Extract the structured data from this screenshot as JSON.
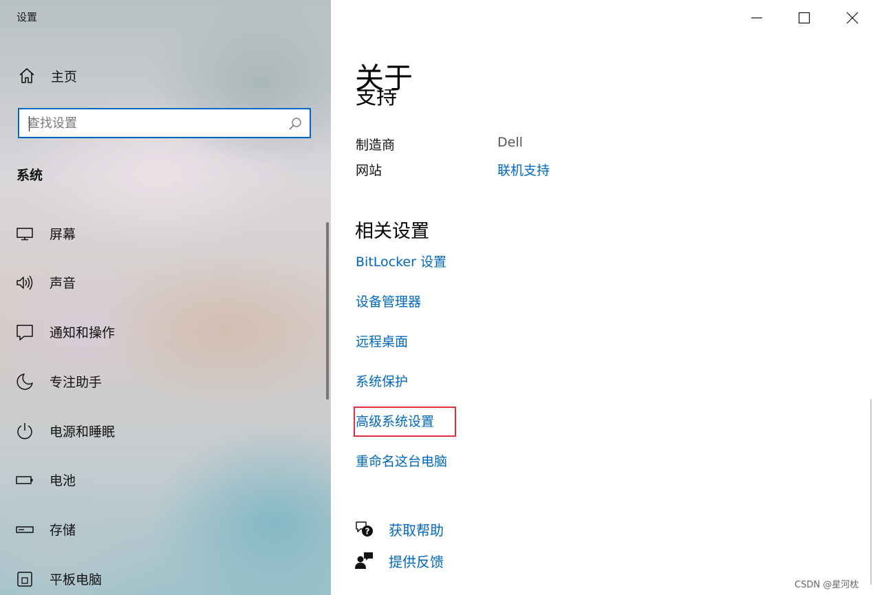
{
  "window": {
    "title": "设置"
  },
  "sidebar": {
    "home_label": "主页",
    "search_placeholder": "查找设置",
    "section_label": "系统",
    "items": [
      {
        "label": "屏幕",
        "icon": "monitor-icon"
      },
      {
        "label": "声音",
        "icon": "speaker-icon"
      },
      {
        "label": "通知和操作",
        "icon": "notification-icon"
      },
      {
        "label": "专注助手",
        "icon": "moon-icon"
      },
      {
        "label": "电源和睡眠",
        "icon": "power-icon"
      },
      {
        "label": "电池",
        "icon": "battery-icon"
      },
      {
        "label": "存储",
        "icon": "storage-icon"
      },
      {
        "label": "平板电脑",
        "icon": "tablet-icon"
      }
    ]
  },
  "content": {
    "page_title": "关于",
    "clipped_heading": "支持",
    "support": {
      "manufacturer_label": "制造商",
      "manufacturer_value": "Dell",
      "website_label": "网站",
      "website_value": "联机支持"
    },
    "related_title": "相关设置",
    "related_links": [
      "BitLocker 设置",
      "设备管理器",
      "远程桌面",
      "系统保护",
      "高级系统设置",
      "重命名这台电脑"
    ],
    "help": {
      "get_help": "获取帮助",
      "feedback": "提供反馈"
    }
  },
  "watermark": "CSDN @星河枕",
  "colors": {
    "link": "#0067c0",
    "highlight": "#e0313b",
    "search_border": "#0067c0"
  }
}
